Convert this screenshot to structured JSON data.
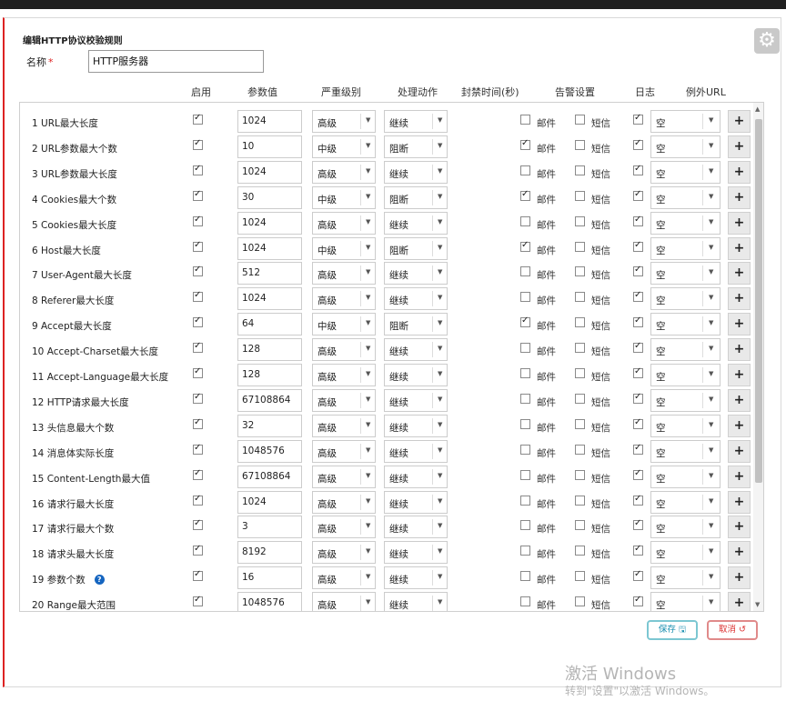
{
  "dialog": {
    "title": "编辑HTTP协议校验规则",
    "name_label": "名称",
    "required_mark": "*",
    "name_value": "HTTP服务器"
  },
  "headers": {
    "enable": "启用",
    "param": "参数值",
    "severity": "严重级别",
    "action": "处理动作",
    "block_time": "封禁时间(秒)",
    "alert": "告警设置",
    "log": "日志",
    "exception": "例外URL"
  },
  "labels": {
    "email": "邮件",
    "sms": "短信"
  },
  "rows": [
    {
      "name": "1  URL最大长度",
      "enabled": true,
      "value": "1024",
      "severity": "高级",
      "action": "继续",
      "email": false,
      "sms": false,
      "log": true,
      "exception": "空"
    },
    {
      "name": "2  URL参数最大个数",
      "enabled": true,
      "value": "10",
      "severity": "中级",
      "action": "阻断",
      "email": true,
      "sms": false,
      "log": true,
      "exception": "空"
    },
    {
      "name": "3  URL参数最大长度",
      "enabled": true,
      "value": "1024",
      "severity": "高级",
      "action": "继续",
      "email": false,
      "sms": false,
      "log": true,
      "exception": "空"
    },
    {
      "name": "4  Cookies最大个数",
      "enabled": true,
      "value": "30",
      "severity": "中级",
      "action": "阻断",
      "email": true,
      "sms": false,
      "log": true,
      "exception": "空"
    },
    {
      "name": "5  Cookies最大长度",
      "enabled": true,
      "value": "1024",
      "severity": "高级",
      "action": "继续",
      "email": false,
      "sms": false,
      "log": true,
      "exception": "空"
    },
    {
      "name": "6  Host最大长度",
      "enabled": true,
      "value": "1024",
      "severity": "中级",
      "action": "阻断",
      "email": true,
      "sms": false,
      "log": true,
      "exception": "空"
    },
    {
      "name": "7  User-Agent最大长度",
      "enabled": true,
      "value": "512",
      "severity": "高级",
      "action": "继续",
      "email": false,
      "sms": false,
      "log": true,
      "exception": "空"
    },
    {
      "name": "8  Referer最大长度",
      "enabled": true,
      "value": "1024",
      "severity": "高级",
      "action": "继续",
      "email": false,
      "sms": false,
      "log": true,
      "exception": "空"
    },
    {
      "name": "9  Accept最大长度",
      "enabled": true,
      "value": "64",
      "severity": "中级",
      "action": "阻断",
      "email": true,
      "sms": false,
      "log": true,
      "exception": "空"
    },
    {
      "name": "10  Accept-Charset最大长度",
      "enabled": true,
      "value": "128",
      "severity": "高级",
      "action": "继续",
      "email": false,
      "sms": false,
      "log": true,
      "exception": "空"
    },
    {
      "name": "11  Accept-Language最大长度",
      "enabled": true,
      "value": "128",
      "severity": "高级",
      "action": "继续",
      "email": false,
      "sms": false,
      "log": true,
      "exception": "空"
    },
    {
      "name": "12  HTTP请求最大长度",
      "enabled": true,
      "value": "67108864",
      "severity": "高级",
      "action": "继续",
      "email": false,
      "sms": false,
      "log": true,
      "exception": "空"
    },
    {
      "name": "13  头信息最大个数",
      "enabled": true,
      "value": "32",
      "severity": "高级",
      "action": "继续",
      "email": false,
      "sms": false,
      "log": true,
      "exception": "空"
    },
    {
      "name": "14  消息体实际长度",
      "enabled": true,
      "value": "1048576",
      "severity": "高级",
      "action": "继续",
      "email": false,
      "sms": false,
      "log": true,
      "exception": "空"
    },
    {
      "name": "15  Content-Length最大值",
      "enabled": true,
      "value": "67108864",
      "severity": "高级",
      "action": "继续",
      "email": false,
      "sms": false,
      "log": true,
      "exception": "空"
    },
    {
      "name": "16  请求行最大长度",
      "enabled": true,
      "value": "1024",
      "severity": "高级",
      "action": "继续",
      "email": false,
      "sms": false,
      "log": true,
      "exception": "空"
    },
    {
      "name": "17  请求行最大个数",
      "enabled": true,
      "value": "3",
      "severity": "高级",
      "action": "继续",
      "email": false,
      "sms": false,
      "log": true,
      "exception": "空"
    },
    {
      "name": "18  请求头最大长度",
      "enabled": true,
      "value": "8192",
      "severity": "高级",
      "action": "继续",
      "email": false,
      "sms": false,
      "log": true,
      "exception": "空"
    },
    {
      "name": "19  参数个数",
      "enabled": true,
      "value": "16",
      "severity": "高级",
      "action": "继续",
      "email": false,
      "sms": false,
      "log": true,
      "exception": "空",
      "help": true
    },
    {
      "name": "20  Range最大范围",
      "enabled": true,
      "value": "1048576",
      "severity": "高级",
      "action": "继续",
      "email": false,
      "sms": false,
      "log": true,
      "exception": "空"
    }
  ],
  "buttons": {
    "save": "保存",
    "cancel": "取消"
  },
  "watermark": {
    "line1": "激活 Windows",
    "line2": "转到\"设置\"以激活 Windows。"
  },
  "icons": {
    "gear": "gear-icon",
    "add": "plus-icon",
    "help": "question-icon",
    "save": "floppy-icon",
    "cancel": "undo-icon"
  }
}
